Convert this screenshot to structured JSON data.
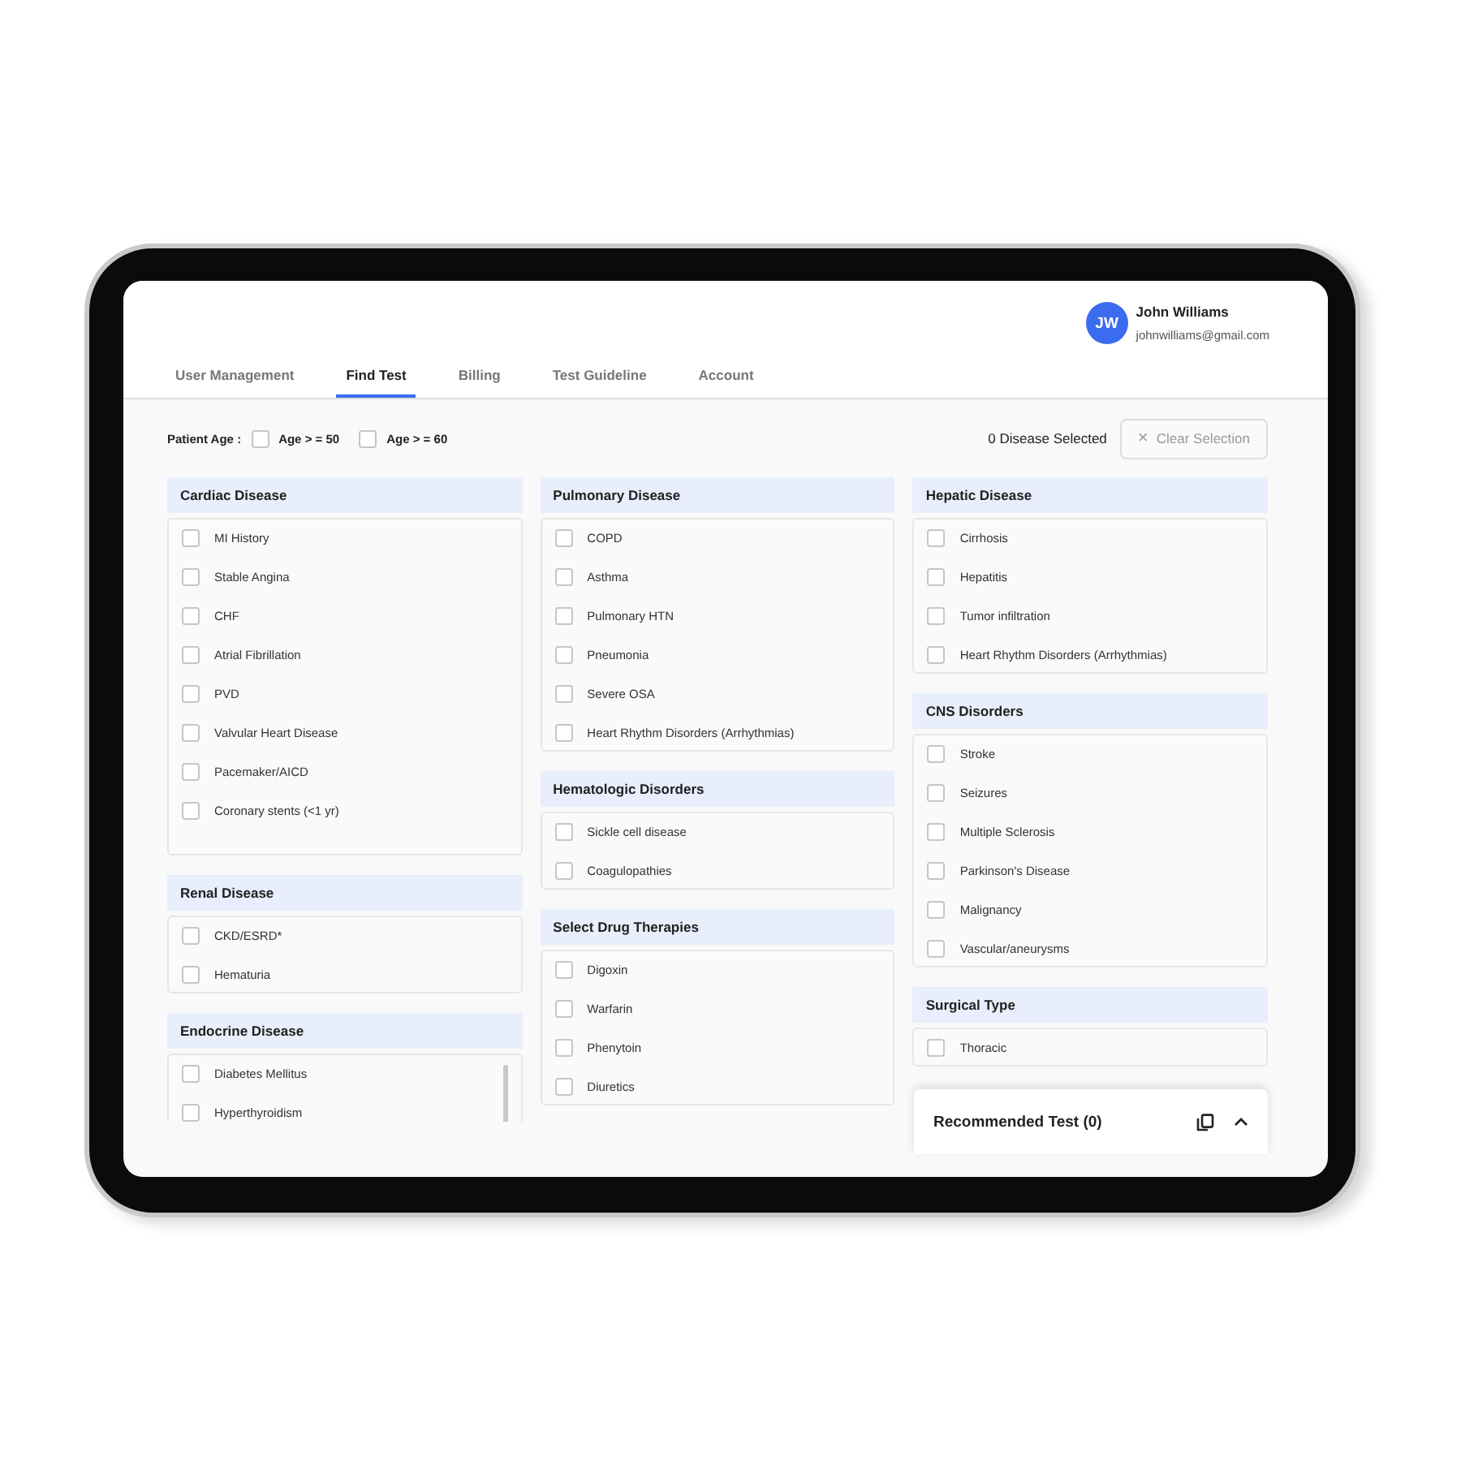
{
  "user": {
    "initials": "JW",
    "name": "John Williams",
    "email": "johnwilliams@gmail.com"
  },
  "tabs": [
    {
      "label": "User Management",
      "selected": false
    },
    {
      "label": "Find Test",
      "selected": true
    },
    {
      "label": "Billing",
      "selected": false
    },
    {
      "label": "Test Guideline",
      "selected": false
    },
    {
      "label": "Account",
      "selected": false
    }
  ],
  "filter": {
    "label": "Patient Age :",
    "options": [
      {
        "label": "Age > = 50",
        "checked": false
      },
      {
        "label": "Age > = 60",
        "checked": false
      }
    ]
  },
  "selected_count": "0 Disease Selected",
  "clear_button": {
    "icon": "×",
    "label": "Clear Selection",
    "disabled": true
  },
  "columns": [
    [
      {
        "title": "Cardiac Disease",
        "items": [
          {
            "label": "MI History",
            "checked": false
          },
          {
            "label": "Stable Angina",
            "checked": false
          },
          {
            "label": "CHF",
            "checked": false
          },
          {
            "label": "Atrial Fibrillation",
            "checked": false
          },
          {
            "label": "PVD",
            "checked": false
          },
          {
            "label": "Valvular Heart Disease",
            "checked": false
          },
          {
            "label": "Pacemaker/AICD",
            "checked": false
          },
          {
            "label": "Coronary stents (<1 yr)",
            "checked": false
          }
        ]
      },
      {
        "title": "Renal Disease",
        "items": [
          {
            "label": "CKD/ESRD*",
            "checked": false
          },
          {
            "label": "Hematuria",
            "checked": false
          }
        ]
      },
      {
        "title": "Endocrine Disease",
        "scrollable": true,
        "items": [
          {
            "label": "Diabetes Mellitus",
            "checked": false
          },
          {
            "label": "Hyperthyroidism",
            "checked": false
          }
        ]
      }
    ],
    [
      {
        "title": "Pulmonary Disease",
        "items": [
          {
            "label": "COPD",
            "checked": false
          },
          {
            "label": "Asthma",
            "checked": false
          },
          {
            "label": "Pulmonary HTN",
            "checked": false
          },
          {
            "label": "Pneumonia",
            "checked": false
          },
          {
            "label": "Severe OSA",
            "checked": false
          },
          {
            "label": "Heart Rhythm Disorders (Arrhythmias)",
            "checked": false
          }
        ]
      },
      {
        "title": "Hematologic Disorders",
        "items": [
          {
            "label": "Sickle cell disease",
            "checked": false
          },
          {
            "label": "Coagulopathies",
            "checked": false
          }
        ]
      },
      {
        "title": "Select Drug Therapies",
        "items": [
          {
            "label": "Digoxin",
            "checked": false
          },
          {
            "label": "Warfarin",
            "checked": false
          },
          {
            "label": "Phenytoin",
            "checked": false
          },
          {
            "label": "Diuretics",
            "checked": false
          }
        ]
      }
    ],
    [
      {
        "title": "Hepatic Disease",
        "items": [
          {
            "label": "Cirrhosis",
            "checked": false
          },
          {
            "label": "Hepatitis",
            "checked": false
          },
          {
            "label": "Tumor infiltration",
            "checked": false
          },
          {
            "label": "Heart Rhythm Disorders (Arrhythmias)",
            "checked": false
          }
        ]
      },
      {
        "title": "CNS Disorders",
        "items": [
          {
            "label": "Stroke",
            "checked": false
          },
          {
            "label": "Seizures",
            "checked": false
          },
          {
            "label": "Multiple Sclerosis",
            "checked": false
          },
          {
            "label": "Parkinson's Disease",
            "checked": false
          },
          {
            "label": "Malignancy",
            "checked": false
          },
          {
            "label": "Vascular/aneurysms",
            "checked": false
          }
        ]
      },
      {
        "title": "Surgical Type",
        "items": [
          {
            "label": "Thoracic",
            "checked": false
          }
        ]
      }
    ]
  ],
  "recommended": {
    "title": "Recommended Test (0)",
    "expanded": false
  }
}
